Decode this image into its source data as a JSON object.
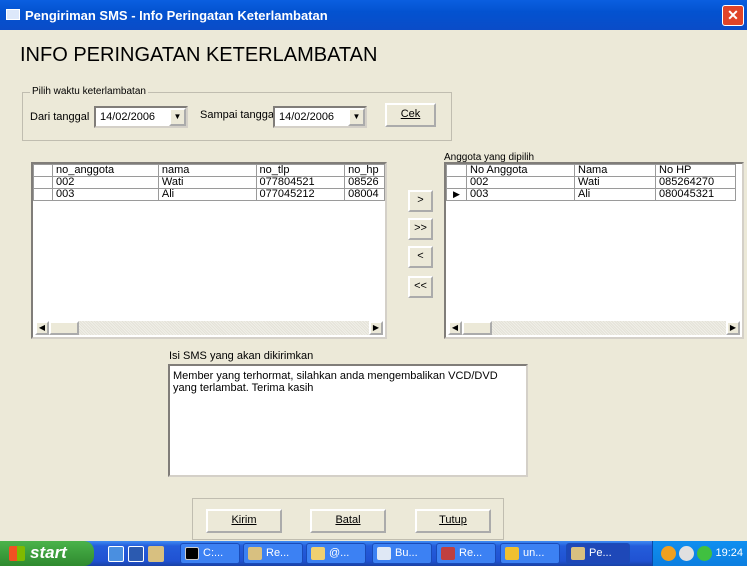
{
  "window": {
    "title": "Pengiriman SMS - Info Peringatan Keterlambatan",
    "close_glyph": "✕"
  },
  "heading": "INFO PERINGATAN KETERLAMBATAN",
  "filter": {
    "legend": "Pilih waktu keterlambatan",
    "from_label": "Dari tanggal",
    "from_value": "14/02/2006",
    "to_label": "Sampai tanggal",
    "to_value": "14/02/2006",
    "check_button": "Cek"
  },
  "left_grid": {
    "columns": [
      "no_anggota",
      "nama",
      "no_tlp",
      "no_hp"
    ],
    "rows": [
      [
        "002",
        "Wati",
        "077804521",
        "08526"
      ],
      [
        "003",
        "Ali",
        "077045212",
        "08004"
      ]
    ]
  },
  "right_grid": {
    "label": "Anggota yang dipilih",
    "columns": [
      "No Anggota",
      "Nama",
      "No HP"
    ],
    "rows": [
      [
        "002",
        "Wati",
        "085264270"
      ],
      [
        "003",
        "Ali",
        "080045321"
      ]
    ],
    "current_row_marker": "▶"
  },
  "move_buttons": {
    "add": ">",
    "add_all": ">>",
    "remove": "<",
    "remove_all": "<<"
  },
  "message": {
    "label": "Isi SMS yang akan dikirimkan",
    "text": "Member yang terhormat, silahkan anda mengembalikan VCD/DVD yang terlambat. Terima kasih"
  },
  "actions": {
    "send": "Kirim",
    "cancel": "Batal",
    "close": "Tutup"
  },
  "taskbar": {
    "start": "start",
    "tasks": [
      "C:...",
      "Re...",
      "@...",
      "Bu...",
      "Re...",
      "un...",
      "Pe..."
    ],
    "clock": "19:24"
  },
  "colors": {
    "titlebar": "#0352d0",
    "dialog_bg": "#ece9d8",
    "close": "#e04428",
    "taskbar": "#245ddb",
    "start": "#3c9e3c"
  }
}
